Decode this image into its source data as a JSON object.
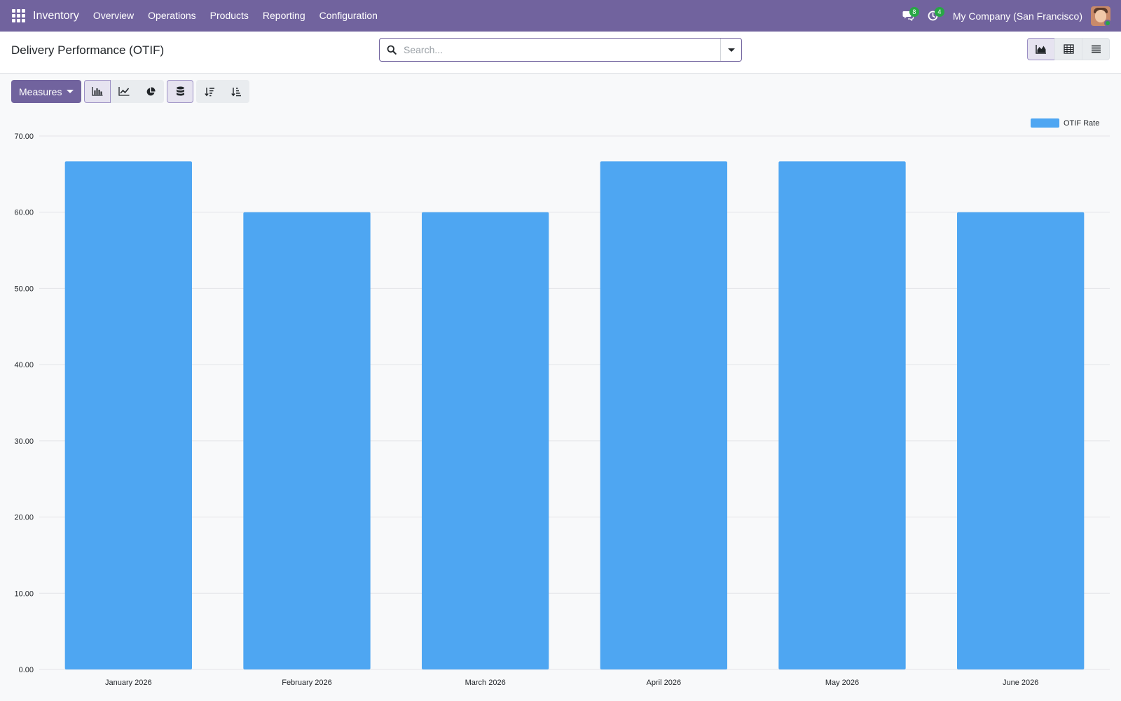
{
  "navbar": {
    "app_name": "Inventory",
    "menu": [
      "Overview",
      "Operations",
      "Products",
      "Reporting",
      "Configuration"
    ],
    "messages_count": "8",
    "activities_count": "4",
    "company": "My Company (San Francisco)"
  },
  "control_panel": {
    "title": "Delivery Performance (OTIF)",
    "search_placeholder": "Search..."
  },
  "toolbar": {
    "measures_label": "Measures"
  },
  "icons": {
    "apps": "apps-grid-icon",
    "messages": "chat-bubble-icon",
    "activities": "clock-icon",
    "search": "search-icon",
    "search_toggle": "caret-down-icon",
    "view_graph": "area-chart-icon",
    "view_pivot": "table-icon",
    "view_list": "list-icon",
    "bar_chart": "bar-chart-icon",
    "line_chart": "line-chart-icon",
    "pie_chart": "pie-chart-icon",
    "stacked": "database-icon",
    "sort_desc": "sort-descending-icon",
    "sort_asc": "sort-ascending-icon"
  },
  "colors": {
    "brand": "#71639e",
    "bar": "#4ea6f2",
    "badge": "#28a745"
  },
  "chart_data": {
    "type": "bar",
    "categories": [
      "January 2026",
      "February 2026",
      "March 2026",
      "April 2026",
      "May 2026",
      "June 2026"
    ],
    "series": [
      {
        "name": "OTIF Rate",
        "values": [
          66.67,
          60.0,
          60.0,
          66.67,
          66.67,
          60.0
        ]
      }
    ],
    "y_ticks": [
      "0.00",
      "10.00",
      "20.00",
      "30.00",
      "40.00",
      "50.00",
      "60.00",
      "70.00"
    ],
    "ylim": [
      0,
      70
    ],
    "grid": true,
    "legend_position": "top-right"
  }
}
